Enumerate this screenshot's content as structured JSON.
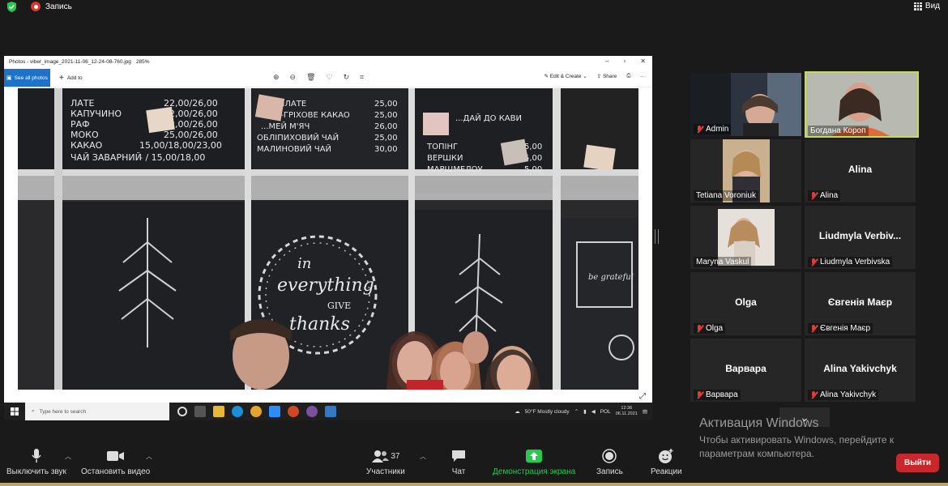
{
  "top": {
    "record_label": "Запись",
    "view_label": "Вид"
  },
  "photos": {
    "filename": "Photos - viber_image_2021-11-06_12-24-08-760.jpg",
    "zoom": "285%",
    "see_all": "See all photos",
    "add_to": "Add to",
    "edit_create": "Edit & Create",
    "share": "Share",
    "photo_text": {
      "menu_left": [
        "ЛАТЕ",
        "КАПУЧИНО",
        "РАФ",
        "МОКО",
        "КАКАО",
        "ЧАЙ ЗАВАРНИЙ"
      ],
      "prices_left": [
        "22,00/26,00",
        "22,00/26,00",
        "22,00/26,00",
        "25,00/26,00",
        "15,00/18,00/23,00",
        "- / 15,00/18,00"
      ],
      "menu_mid": [
        "...РЕНЛАТЕ",
        "...ВО-ГРІХОВЕ КАКАО",
        "...МЕЙ М'ЯЧ",
        "ОБЛІПИХОВИЙ ЧАЙ",
        "МАЛИНОВИЙ ЧАЙ"
      ],
      "prices_mid": [
        "25,00",
        "25,00",
        "26,00",
        "25,00",
        "30,00"
      ],
      "menu_right": [
        "...ДАЙ ДО КАВИ",
        "ТОПІНГ",
        "ВЕРШКИ",
        "МАРШМЕЛОУ"
      ],
      "prices_right": [
        "5,00",
        "5,00",
        "5,00"
      ],
      "wreath_lines": [
        "in",
        "everything",
        "GIVE",
        "thanks"
      ],
      "sign_right": "be grateful"
    },
    "taskbar": {
      "search_placeholder": "Type here to search",
      "weather": "50°F  Mostly cloudy",
      "lang": "POL",
      "time": "12:36",
      "date": "06.11.2021"
    }
  },
  "participants": [
    {
      "name": "Admin",
      "muted": true
    },
    {
      "name": "Богдана Короп",
      "muted": false,
      "active_speaker": true
    },
    {
      "name": "Tetiana Voroniuk",
      "muted": false
    },
    {
      "name": "Alina",
      "muted": true,
      "display": "Alina"
    },
    {
      "name": "Maryna Vaskul",
      "muted": false
    },
    {
      "name": "Liudmyla Verbivska",
      "muted": true,
      "display": "Liudmyla  Verbiv..."
    },
    {
      "name": "Olga",
      "muted": true,
      "display": "Olga"
    },
    {
      "name": "Євгенія Маєр",
      "muted": true,
      "display": "Євгенія Маєр"
    },
    {
      "name": "Варвара",
      "muted": true,
      "display": "Варвара"
    },
    {
      "name": "Alina Yakivchyk",
      "muted": true,
      "display": "Alina Yakivchyk"
    }
  ],
  "activation": {
    "title": "Активация Windows",
    "text": "Чтобы активировать Windows, перейдите к параметрам компьютера."
  },
  "toolbar": {
    "mute": "Выключить звук",
    "video": "Остановить видео",
    "participants": "Участники",
    "participants_count": "37",
    "chat": "Чат",
    "share": "Демонстрация экрана",
    "record": "Запись",
    "reactions": "Реакции",
    "exit": "Выйти"
  },
  "colors": {
    "accent_green": "#2ac84f",
    "active_border": "#c5dc55",
    "exit_red": "#c8282b",
    "mute_red": "#e03b3b"
  }
}
